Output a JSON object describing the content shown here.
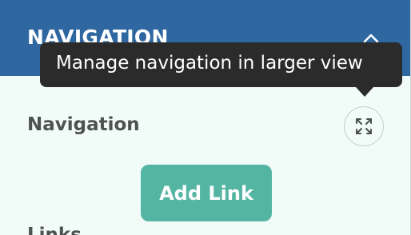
{
  "header": {
    "title": "NAVIGATION",
    "collapse_icon": "chevron-up-icon",
    "background": "#2f67a1"
  },
  "tooltip": {
    "text": "Manage navigation in larger view"
  },
  "section": {
    "title": "Navigation",
    "expand_icon": "expand-arrows-icon"
  },
  "actions": {
    "add_link_label": "Add Link",
    "accent": "#55b5a3"
  },
  "links": {
    "heading": "Links"
  }
}
